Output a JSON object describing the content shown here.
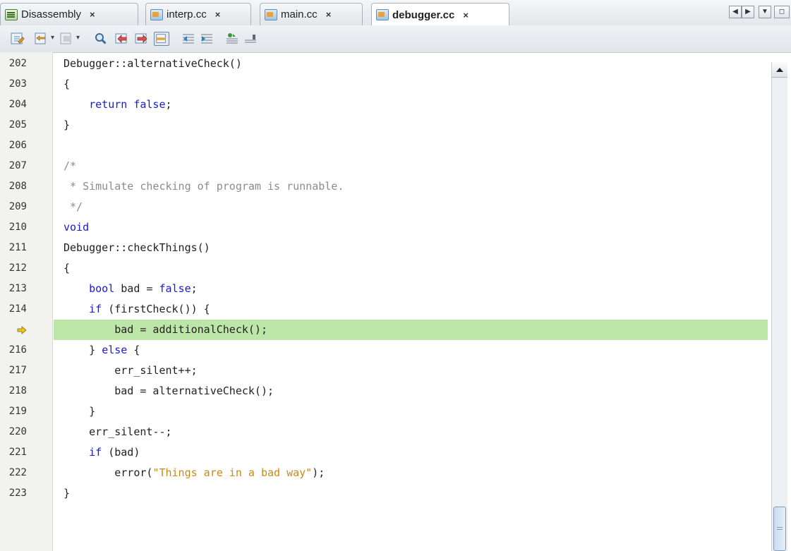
{
  "tabs": [
    {
      "label": "Disassembly",
      "icon": "disassembly-file-icon",
      "active": false
    },
    {
      "label": "interp.cc",
      "icon": "cc-file-icon",
      "active": false
    },
    {
      "label": "main.cc",
      "icon": "cc-file-icon",
      "active": false
    },
    {
      "label": "debugger.cc",
      "icon": "cc-file-icon",
      "active": true
    }
  ],
  "tab_close_glyph": "×",
  "editor": {
    "current_line": 215,
    "current_line_color": "#bde6a9",
    "lines": [
      {
        "num": "202",
        "code": [
          {
            "t": "Debugger::alternativeCheck()",
            "c": "plain"
          }
        ]
      },
      {
        "num": "203",
        "code": [
          {
            "t": "{",
            "c": "plain"
          }
        ]
      },
      {
        "num": "204",
        "code": [
          {
            "t": "    ",
            "c": "plain"
          },
          {
            "t": "return false",
            "c": "kw"
          },
          {
            "t": ";",
            "c": "plain"
          }
        ]
      },
      {
        "num": "205",
        "code": [
          {
            "t": "}",
            "c": "plain"
          }
        ]
      },
      {
        "num": "206",
        "code": [
          {
            "t": "",
            "c": "plain"
          }
        ]
      },
      {
        "num": "207",
        "code": [
          {
            "t": "/*",
            "c": "cm"
          }
        ]
      },
      {
        "num": "208",
        "code": [
          {
            "t": " * Simulate checking of program is runnable.",
            "c": "cm"
          }
        ]
      },
      {
        "num": "209",
        "code": [
          {
            "t": " */",
            "c": "cm"
          }
        ]
      },
      {
        "num": "210",
        "code": [
          {
            "t": "void",
            "c": "kw"
          }
        ]
      },
      {
        "num": "211",
        "code": [
          {
            "t": "Debugger::checkThings()",
            "c": "plain"
          }
        ]
      },
      {
        "num": "212",
        "code": [
          {
            "t": "{",
            "c": "plain"
          }
        ]
      },
      {
        "num": "213",
        "code": [
          {
            "t": "    ",
            "c": "plain"
          },
          {
            "t": "bool",
            "c": "kw"
          },
          {
            "t": " bad = ",
            "c": "plain"
          },
          {
            "t": "false",
            "c": "kw"
          },
          {
            "t": ";",
            "c": "plain"
          }
        ]
      },
      {
        "num": "214",
        "code": [
          {
            "t": "    ",
            "c": "plain"
          },
          {
            "t": "if",
            "c": "kw"
          },
          {
            "t": " (firstCheck()) {",
            "c": "plain"
          }
        ]
      },
      {
        "num": "",
        "code": [
          {
            "t": "        bad = additionalCheck();",
            "c": "plain"
          }
        ],
        "current": true
      },
      {
        "num": "216",
        "code": [
          {
            "t": "    } ",
            "c": "plain"
          },
          {
            "t": "else",
            "c": "kw"
          },
          {
            "t": " {",
            "c": "plain"
          }
        ]
      },
      {
        "num": "217",
        "code": [
          {
            "t": "        err_silent++;",
            "c": "plain"
          }
        ]
      },
      {
        "num": "218",
        "code": [
          {
            "t": "        bad = alternativeCheck();",
            "c": "plain"
          }
        ]
      },
      {
        "num": "219",
        "code": [
          {
            "t": "    }",
            "c": "plain"
          }
        ]
      },
      {
        "num": "220",
        "code": [
          {
            "t": "    err_silent--;",
            "c": "plain"
          }
        ]
      },
      {
        "num": "221",
        "code": [
          {
            "t": "    ",
            "c": "plain"
          },
          {
            "t": "if",
            "c": "kw"
          },
          {
            "t": " (bad)",
            "c": "plain"
          }
        ]
      },
      {
        "num": "222",
        "code": [
          {
            "t": "        error(",
            "c": "plain"
          },
          {
            "t": "\"Things are in a bad way\"",
            "c": "str"
          },
          {
            "t": ");",
            "c": "plain"
          }
        ]
      },
      {
        "num": "223",
        "code": [
          {
            "t": "}",
            "c": "plain"
          }
        ]
      }
    ]
  },
  "colors": {
    "keyword": "#1a1ad4",
    "comment": "#8c8c8c",
    "string": "#c98a18",
    "pc_arrow": "#f0c419"
  }
}
